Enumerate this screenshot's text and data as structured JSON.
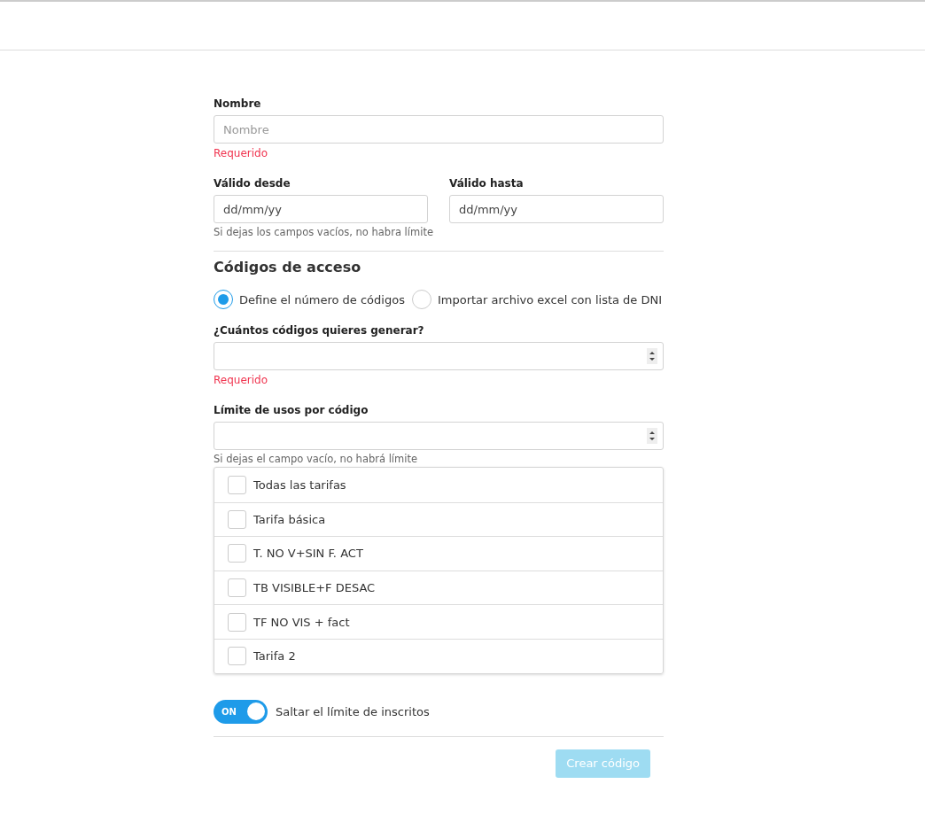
{
  "name_field": {
    "label": "Nombre",
    "placeholder": "Nombre",
    "error": "Requerido"
  },
  "dates": [
    {
      "label": "Válido desde",
      "value": "dd/mm/yy"
    },
    {
      "label": "Válido hasta",
      "value": "dd/mm/yy"
    }
  ],
  "dates_hint": "Si dejas los campos vacíos, no habra límite",
  "section_title": "Códigos de acceso",
  "modes": [
    {
      "label": "Define el número de códigos",
      "selected": true
    },
    {
      "label": "Importar archivo excel con lista de DNI",
      "selected": false
    }
  ],
  "count_field": {
    "label": "¿Cuántos códigos quieres generar?",
    "error": "Requerido"
  },
  "limit_field": {
    "label": "Límite de usos por código",
    "hint": "Si dejas el campo vacío, no habrá límite"
  },
  "rates": [
    {
      "label": "Todas las tarifas",
      "checked": false
    },
    {
      "label": "Tarifa básica",
      "checked": false
    },
    {
      "label": "T. NO V+SIN F. ACT",
      "checked": false
    },
    {
      "label": "TB VISIBLE+F DESAC",
      "checked": false
    },
    {
      "label": "TF NO VIS + fact",
      "checked": false
    },
    {
      "label": "Tarifa 2",
      "checked": false
    }
  ],
  "toggle": {
    "text": "ON",
    "on": true,
    "label": "Saltar el límite de inscritos"
  },
  "submit": {
    "label": "Crear código",
    "disabled": true
  }
}
